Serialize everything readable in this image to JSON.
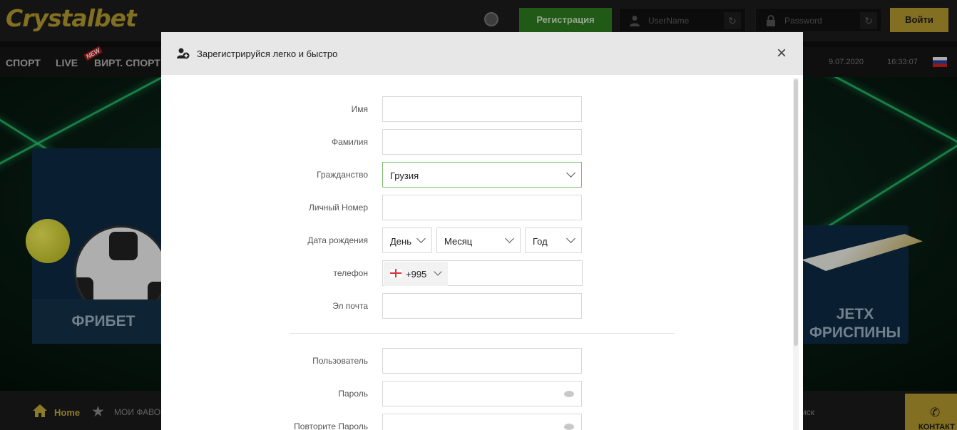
{
  "header": {
    "logo": "Crystalbet",
    "register_label": "Регистрация",
    "username_placeholder": "UserName",
    "password_placeholder": "Password",
    "login_label": "Войти"
  },
  "nav": {
    "items": [
      "СПОРТ",
      "LIVE",
      "ВИРТ. СПОРТ"
    ],
    "new_badge": "NEW",
    "date": "9.07.2020",
    "time": "16:33:07"
  },
  "hero": {
    "left_card": "ФРИБЕТ",
    "right_card_line1": "JETX",
    "right_card_line2": "ФРИСПИНЫ"
  },
  "bottom": {
    "home": "Home",
    "favorites": "МОИ ФАВО",
    "search_tail": "иск",
    "contact": "КОНТАКТ"
  },
  "modal": {
    "title": "Зарегистрируйся легко и быстро",
    "fields": {
      "first_name": "Имя",
      "last_name": "Фамилия",
      "citizenship": "Гражданство",
      "citizenship_value": "Грузия",
      "personal_number": "Личный Номер",
      "birth_date": "Дата рождения",
      "day": "День",
      "month": "Месяц",
      "year": "Год",
      "phone": "телефон",
      "phone_code": "+995",
      "email": "Эл почта",
      "username": "Пользователь",
      "password": "Пароль",
      "repeat_password": "Повторите Пароль"
    }
  },
  "colors": {
    "accent_gold": "#b49a2e",
    "register_green": "#2f7d1f",
    "active_border": "#7dbb6e"
  }
}
